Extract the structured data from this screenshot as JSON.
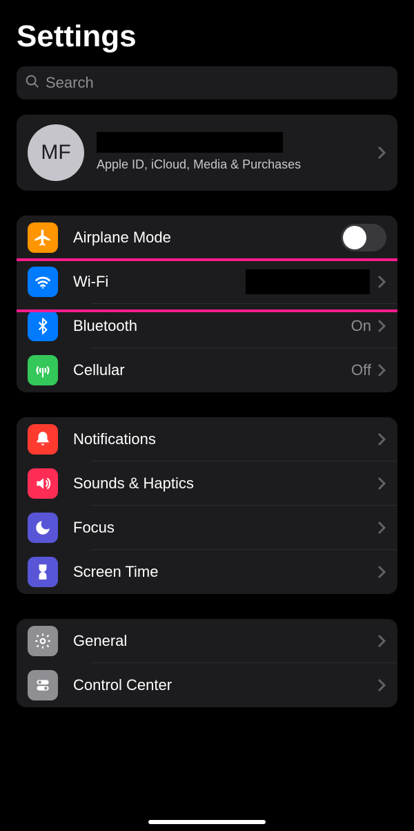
{
  "title": "Settings",
  "search": {
    "placeholder": "Search"
  },
  "account": {
    "initials": "MF",
    "subtitle": "Apple ID, iCloud, Media & Purchases"
  },
  "group1": {
    "airplane": {
      "label": "Airplane Mode",
      "on": false
    },
    "wifi": {
      "label": "Wi-Fi",
      "detail": ""
    },
    "bluetooth": {
      "label": "Bluetooth",
      "detail": "On"
    },
    "cellular": {
      "label": "Cellular",
      "detail": "Off"
    }
  },
  "group2": {
    "notifications": {
      "label": "Notifications"
    },
    "sounds": {
      "label": "Sounds & Haptics"
    },
    "focus": {
      "label": "Focus"
    },
    "screentime": {
      "label": "Screen Time"
    }
  },
  "group3": {
    "general": {
      "label": "General"
    },
    "controlcenter": {
      "label": "Control Center"
    }
  }
}
